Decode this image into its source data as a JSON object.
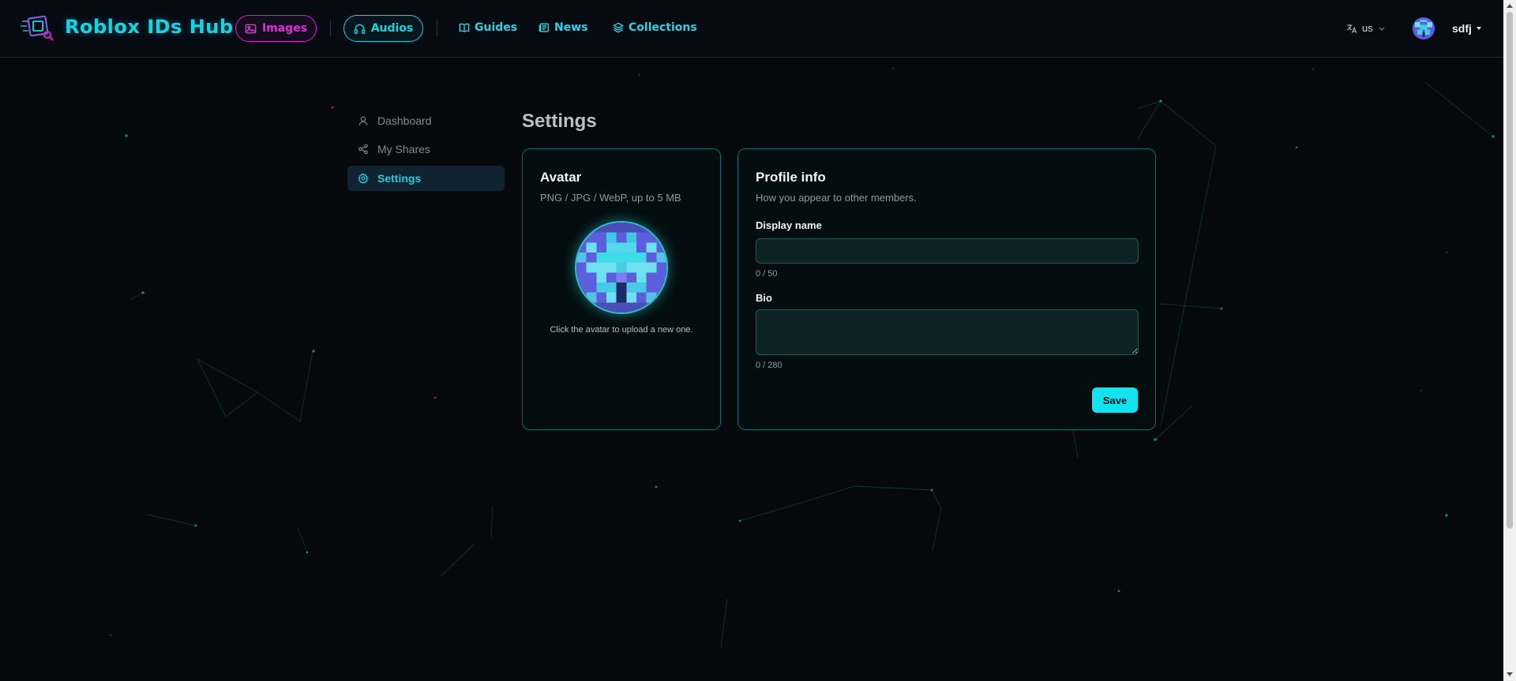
{
  "header": {
    "brand": "Roblox IDs Hub",
    "nav_images": "Images",
    "nav_audios": "Audios",
    "nav_guides": "Guides",
    "nav_news": "News",
    "nav_collections": "Collections",
    "language": "us",
    "username": "sdfj"
  },
  "sidebar": {
    "items": [
      {
        "label": "Dashboard",
        "icon": "user-icon",
        "active": false
      },
      {
        "label": "My Shares",
        "icon": "share-icon",
        "active": false
      },
      {
        "label": "Settings",
        "icon": "gear-icon",
        "active": true
      }
    ]
  },
  "main": {
    "title": "Settings",
    "avatar_card": {
      "title": "Avatar",
      "subtitle": "PNG / JPG / WebP, up to 5 MB",
      "hint": "Click the avatar to upload a new one."
    },
    "profile_card": {
      "title": "Profile info",
      "subtitle": "How you appear to other members.",
      "display_name_label": "Display name",
      "display_name_value": "",
      "display_name_counter": "0 / 50",
      "bio_label": "Bio",
      "bio_value": "",
      "bio_counter": "0 / 280",
      "save_label": "Save"
    }
  },
  "colors": {
    "accent_cyan": "#13e2f0",
    "accent_magenta": "#d81fd3",
    "background": "#05090b",
    "card_border": "#0f6b72"
  }
}
